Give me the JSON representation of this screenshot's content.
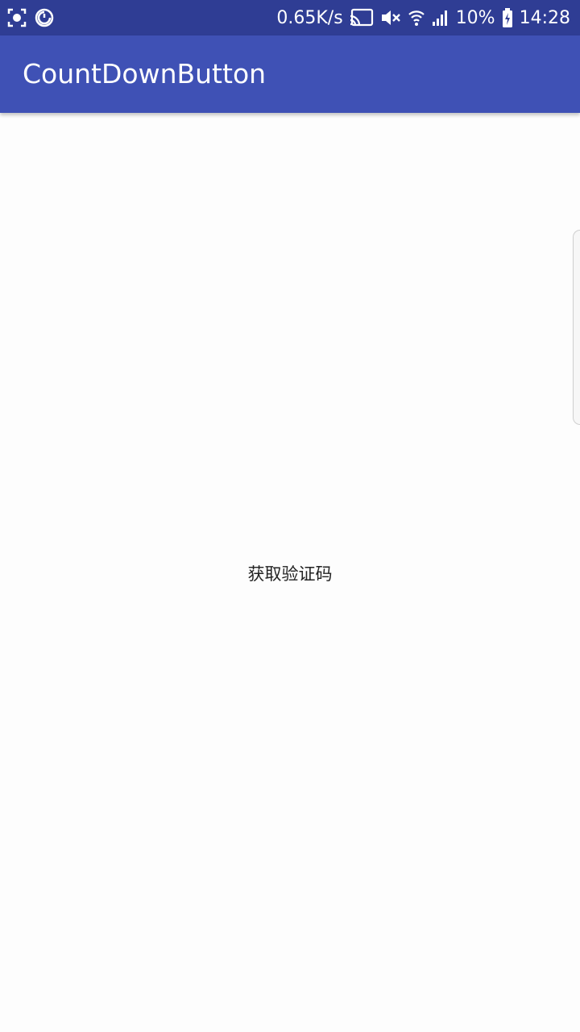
{
  "status_bar": {
    "network_speed": "0.65K/s",
    "battery": "10%",
    "time": "14:28",
    "left_icons": [
      "screenshot-icon",
      "sync-icon"
    ],
    "right_icons": [
      "cast-icon",
      "mute-icon",
      "wifi-icon",
      "signal-icon",
      "battery-charging-icon"
    ]
  },
  "app_bar": {
    "title": "CountDownButton"
  },
  "main": {
    "countdown_button_label": "获取验证码"
  },
  "colors": {
    "status_bar": "#2f3d94",
    "app_bar": "#3f51b5",
    "background": "#fdfdfd",
    "text_primary": "#222222"
  }
}
